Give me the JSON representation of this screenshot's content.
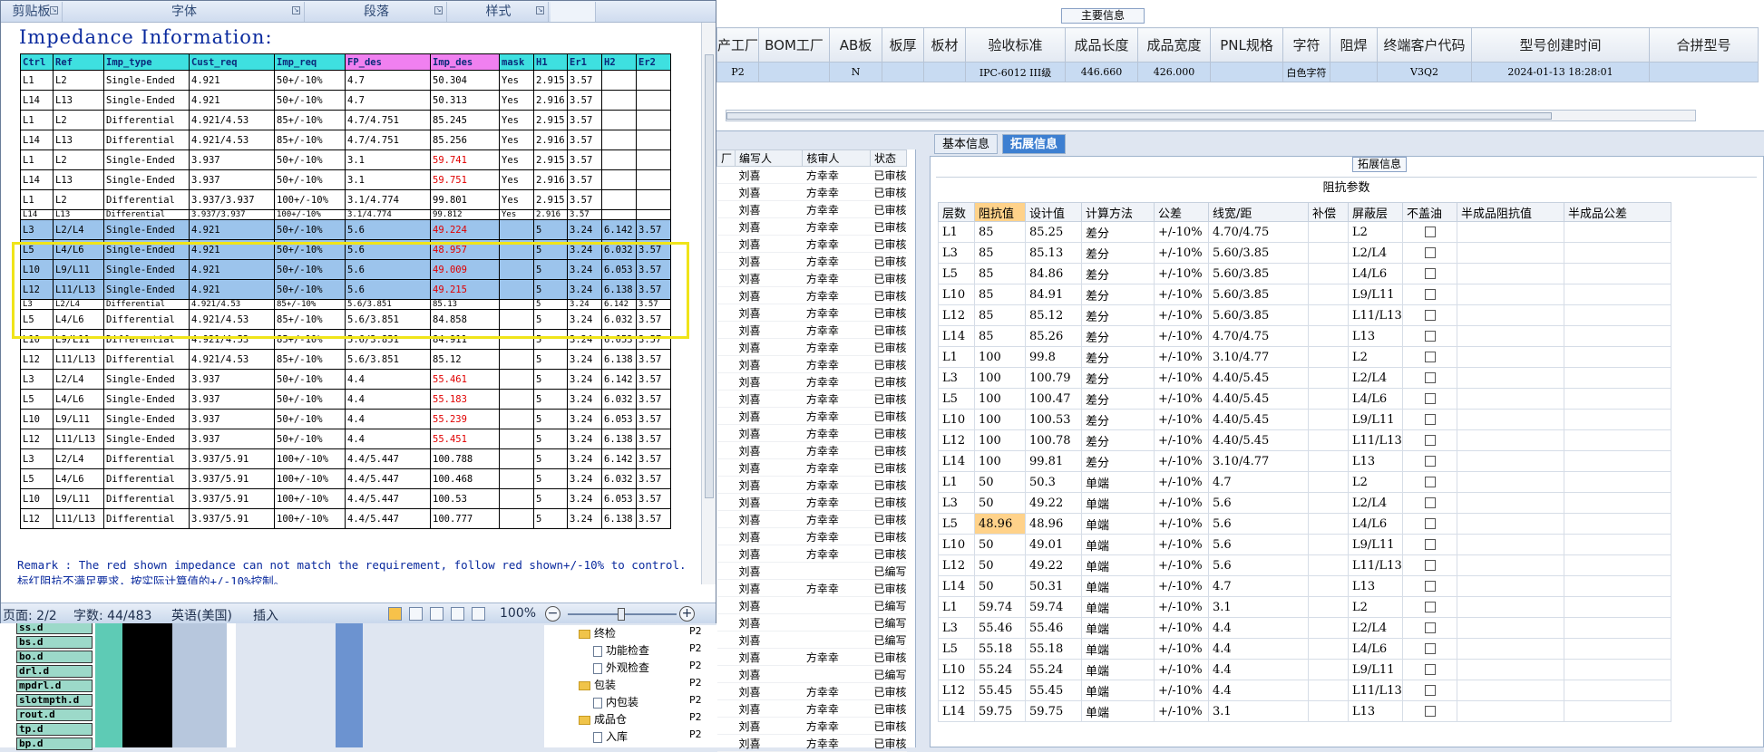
{
  "word": {
    "ribbon_groups": [
      {
        "label": "剪贴板"
      },
      {
        "label": "字体"
      },
      {
        "label": "段落"
      },
      {
        "label": "样式"
      }
    ],
    "doc_title": "Impedance Information:",
    "table_headers": [
      "Ctrl",
      "Ref",
      "Imp_type",
      "Cust_req",
      "Imp_req",
      "FP_des",
      "Imp_des",
      "mask",
      "H1",
      "Er1",
      "H2",
      "Er2"
    ],
    "header_colors": [
      "#3ee0e0",
      "#3ee0e0",
      "#3ee0e0",
      "#3ee0e0",
      "#3ee0e0",
      "#f080f0",
      "#f080f0",
      "#3ee0e0",
      "#3ee0e0",
      "#3ee0e0",
      "#3ee0e0",
      "#3ee0e0"
    ],
    "rows": [
      {
        "cells": [
          "L1",
          "L2",
          "Single-Ended",
          "4.921",
          "50+/-10%",
          "4.7",
          "50.304",
          "Yes",
          "2.915",
          "3.57",
          "",
          ""
        ]
      },
      {
        "cells": [
          "L14",
          "L13",
          "Single-Ended",
          "4.921",
          "50+/-10%",
          "4.7",
          "50.313",
          "Yes",
          "2.916",
          "3.57",
          "",
          ""
        ]
      },
      {
        "cells": [
          "L1",
          "L2",
          "Differential",
          "4.921/4.53",
          "85+/-10%",
          "4.7/4.751",
          "85.245",
          "Yes",
          "2.915",
          "3.57",
          "",
          ""
        ]
      },
      {
        "cells": [
          "L14",
          "L13",
          "Differential",
          "4.921/4.53",
          "85+/-10%",
          "4.7/4.751",
          "85.256",
          "Yes",
          "2.916",
          "3.57",
          "",
          ""
        ]
      },
      {
        "cells": [
          "L1",
          "L2",
          "Single-Ended",
          "3.937",
          "50+/-10%",
          "3.1",
          "59.741",
          "Yes",
          "2.915",
          "3.57",
          "",
          ""
        ],
        "red": true
      },
      {
        "cells": [
          "L14",
          "L13",
          "Single-Ended",
          "3.937",
          "50+/-10%",
          "3.1",
          "59.751",
          "Yes",
          "2.916",
          "3.57",
          "",
          ""
        ],
        "red": true
      },
      {
        "cells": [
          "L1",
          "L2",
          "Differential",
          "3.937/3.937",
          "100+/-10%",
          "3.1/4.774",
          "99.801",
          "Yes",
          "2.915",
          "3.57",
          "",
          ""
        ]
      },
      {
        "cells": [
          "L14",
          "L13",
          "Differential",
          "3.937/3.937",
          "100+/-10%",
          "3.1/4.774",
          "99.812",
          "Yes",
          "2.916",
          "3.57",
          "",
          ""
        ],
        "cut": true
      },
      {
        "cells": [
          "L3",
          "L2/L4",
          "Single-Ended",
          "4.921",
          "50+/-10%",
          "5.6",
          "49.224",
          "",
          "5",
          "3.24",
          "6.142",
          "3.57"
        ],
        "red": true,
        "sel": true
      },
      {
        "cells": [
          "L5",
          "L4/L6",
          "Single-Ended",
          "4.921",
          "50+/-10%",
          "5.6",
          "48.957",
          "",
          "5",
          "3.24",
          "6.032",
          "3.57"
        ],
        "red": true,
        "sel": true
      },
      {
        "cells": [
          "L10",
          "L9/L11",
          "Single-Ended",
          "4.921",
          "50+/-10%",
          "5.6",
          "49.009",
          "",
          "5",
          "3.24",
          "6.053",
          "3.57"
        ],
        "red": true,
        "sel": true
      },
      {
        "cells": [
          "L12",
          "L11/L13",
          "Single-Ended",
          "4.921",
          "50+/-10%",
          "5.6",
          "49.215",
          "",
          "5",
          "3.24",
          "6.138",
          "3.57"
        ],
        "red": true,
        "sel": true
      },
      {
        "cells": [
          "L3",
          "L2/L4",
          "Differential",
          "4.921/4.53",
          "85+/-10%",
          "5.6/3.851",
          "85.13",
          "",
          "5",
          "3.24",
          "6.142",
          "3.57"
        ],
        "cut": true
      },
      {
        "cells": [
          "L5",
          "L4/L6",
          "Differential",
          "4.921/4.53",
          "85+/-10%",
          "5.6/3.851",
          "84.858",
          "",
          "5",
          "3.24",
          "6.032",
          "3.57"
        ]
      },
      {
        "cells": [
          "L10",
          "L9/L11",
          "Differential",
          "4.921/4.53",
          "85+/-10%",
          "5.6/3.851",
          "84.911",
          "",
          "5",
          "3.24",
          "6.053",
          "3.57"
        ]
      },
      {
        "cells": [
          "L12",
          "L11/L13",
          "Differential",
          "4.921/4.53",
          "85+/-10%",
          "5.6/3.851",
          "85.12",
          "",
          "5",
          "3.24",
          "6.138",
          "3.57"
        ]
      },
      {
        "cells": [
          "L3",
          "L2/L4",
          "Single-Ended",
          "3.937",
          "50+/-10%",
          "4.4",
          "55.461",
          "",
          "5",
          "3.24",
          "6.142",
          "3.57"
        ],
        "red": true
      },
      {
        "cells": [
          "L5",
          "L4/L6",
          "Single-Ended",
          "3.937",
          "50+/-10%",
          "4.4",
          "55.183",
          "",
          "5",
          "3.24",
          "6.032",
          "3.57"
        ],
        "red": true
      },
      {
        "cells": [
          "L10",
          "L9/L11",
          "Single-Ended",
          "3.937",
          "50+/-10%",
          "4.4",
          "55.239",
          "",
          "5",
          "3.24",
          "6.053",
          "3.57"
        ],
        "red": true
      },
      {
        "cells": [
          "L12",
          "L11/L13",
          "Single-Ended",
          "3.937",
          "50+/-10%",
          "4.4",
          "55.451",
          "",
          "5",
          "3.24",
          "6.138",
          "3.57"
        ],
        "red": true
      },
      {
        "cells": [
          "L3",
          "L2/L4",
          "Differential",
          "3.937/5.91",
          "100+/-10%",
          "4.4/5.447",
          "100.788",
          "",
          "5",
          "3.24",
          "6.142",
          "3.57"
        ]
      },
      {
        "cells": [
          "L5",
          "L4/L6",
          "Differential",
          "3.937/5.91",
          "100+/-10%",
          "4.4/5.447",
          "100.468",
          "",
          "5",
          "3.24",
          "6.032",
          "3.57"
        ]
      },
      {
        "cells": [
          "L10",
          "L9/L11",
          "Differential",
          "3.937/5.91",
          "100+/-10%",
          "4.4/5.447",
          "100.53",
          "",
          "5",
          "3.24",
          "6.053",
          "3.57"
        ]
      },
      {
        "cells": [
          "L12",
          "L11/L13",
          "Differential",
          "3.937/5.91",
          "100+/-10%",
          "4.4/5.447",
          "100.777",
          "",
          "5",
          "3.24",
          "6.138",
          "3.57"
        ]
      }
    ],
    "remark": "Remark : The red shown impedance can not match the requirement, follow red shown+/-10% to control.标红阻抗不满足要求，按实际计算值的+/-10%控制。",
    "status": {
      "page": "页面: 2/2",
      "words": "字数: 44/483",
      "language": "英语(美国)",
      "mode": "插入",
      "zoom": "100%"
    }
  },
  "file_list": [
    "ss.d",
    "bs.d",
    "bo.d",
    "drl.d",
    "mpdrl.d",
    "slotmpth.d",
    "rout.d",
    "tp.d",
    "bp.d"
  ],
  "main_info": {
    "title": "主要信息",
    "headers": [
      "产工厂",
      "BOM工厂",
      "AB板",
      "板厚",
      "板材",
      "验收标准",
      "成品长度",
      "成品宽度",
      "PNL规格",
      "字符",
      "阻焊",
      "终端客户代码",
      "型号创建时间",
      "合拼型号"
    ],
    "row": [
      "P2",
      "",
      "N",
      "",
      "",
      "IPC-6012 III级",
      "446.660",
      "426.000",
      "",
      "白色字符",
      "",
      "V3Q2",
      "2024-01-13 18:28:01",
      ""
    ]
  },
  "mini_list": {
    "headers": [
      "厂",
      "编写人",
      "核审人",
      "状态"
    ],
    "rows": [
      [
        "",
        "刘喜",
        "方幸幸",
        "已审核"
      ],
      [
        "",
        "刘喜",
        "方幸幸",
        "已审核"
      ],
      [
        "",
        "刘喜",
        "方幸幸",
        "已审核"
      ],
      [
        "",
        "刘喜",
        "方幸幸",
        "已审核"
      ],
      [
        "",
        "刘喜",
        "方幸幸",
        "已审核"
      ],
      [
        "",
        "刘喜",
        "方幸幸",
        "已审核"
      ],
      [
        "",
        "刘喜",
        "方幸幸",
        "已审核"
      ],
      [
        "",
        "刘喜",
        "方幸幸",
        "已审核"
      ],
      [
        "",
        "刘喜",
        "方幸幸",
        "已审核"
      ],
      [
        "",
        "刘喜",
        "方幸幸",
        "已审核"
      ],
      [
        "",
        "刘喜",
        "方幸幸",
        "已审核"
      ],
      [
        "",
        "刘喜",
        "方幸幸",
        "已审核"
      ],
      [
        "",
        "刘喜",
        "方幸幸",
        "已审核"
      ],
      [
        "",
        "刘喜",
        "方幸幸",
        "已审核"
      ],
      [
        "",
        "刘喜",
        "方幸幸",
        "已审核"
      ],
      [
        "",
        "刘喜",
        "方幸幸",
        "已审核"
      ],
      [
        "",
        "刘喜",
        "方幸幸",
        "已审核"
      ],
      [
        "",
        "刘喜",
        "方幸幸",
        "已审核"
      ],
      [
        "",
        "刘喜",
        "方幸幸",
        "已审核"
      ],
      [
        "",
        "刘喜",
        "方幸幸",
        "已审核"
      ],
      [
        "",
        "刘喜",
        "方幸幸",
        "已审核"
      ],
      [
        "",
        "刘喜",
        "方幸幸",
        "已审核"
      ],
      [
        "",
        "刘喜",
        "方幸幸",
        "已审核"
      ],
      [
        "",
        "刘喜",
        "",
        "已编写"
      ],
      [
        "",
        "刘喜",
        "方幸幸",
        "已审核"
      ],
      [
        "",
        "刘喜",
        "",
        "已编写"
      ],
      [
        "",
        "刘喜",
        "",
        "已编写"
      ],
      [
        "",
        "刘喜",
        "",
        "已编写"
      ],
      [
        "",
        "刘喜",
        "方幸幸",
        "已审核"
      ],
      [
        "",
        "刘喜",
        "",
        "已编写"
      ],
      [
        "",
        "刘喜",
        "方幸幸",
        "已审核"
      ],
      [
        "",
        "刘喜",
        "方幸幸",
        "已审核"
      ],
      [
        "",
        "刘喜",
        "方幸幸",
        "已审核"
      ],
      [
        "",
        "刘喜",
        "方幸幸",
        "已审核"
      ]
    ]
  },
  "tree": [
    {
      "label": "终检",
      "type": "folder",
      "plant": "P2",
      "indent": 0
    },
    {
      "label": "功能检查",
      "type": "doc",
      "plant": "P2",
      "indent": 1
    },
    {
      "label": "外观检查",
      "type": "doc",
      "plant": "P2",
      "indent": 1
    },
    {
      "label": "包装",
      "type": "folder",
      "plant": "P2",
      "indent": 0
    },
    {
      "label": "内包装",
      "type": "doc",
      "plant": "P2",
      "indent": 1
    },
    {
      "label": "成品仓",
      "type": "folder",
      "plant": "P2",
      "indent": 0
    },
    {
      "label": "入库",
      "type": "doc",
      "plant": "P2",
      "indent": 1
    }
  ],
  "tabs": [
    {
      "label": "基本信息",
      "active": false
    },
    {
      "label": "拓展信息",
      "active": true
    }
  ],
  "ext": {
    "section_title": "拓展信息",
    "sub_title": "阻抗参数",
    "headers": [
      "层数",
      "阻抗值",
      "设计值",
      "计算方法",
      "公差",
      "线宽/距",
      "补偿",
      "屏蔽层",
      "不盖油",
      "半成品阻抗值",
      "半成品公差"
    ],
    "rows": [
      [
        "L1",
        "85",
        "85.25",
        "差分",
        "+/-10%",
        "4.70/4.75",
        "",
        "L2"
      ],
      [
        "L3",
        "85",
        "85.13",
        "差分",
        "+/-10%",
        "5.60/3.85",
        "",
        "L2/L4"
      ],
      [
        "L5",
        "85",
        "84.86",
        "差分",
        "+/-10%",
        "5.60/3.85",
        "",
        "L4/L6"
      ],
      [
        "L10",
        "85",
        "84.91",
        "差分",
        "+/-10%",
        "5.60/3.85",
        "",
        "L9/L11"
      ],
      [
        "L12",
        "85",
        "85.12",
        "差分",
        "+/-10%",
        "5.60/3.85",
        "",
        "L11/L13"
      ],
      [
        "L14",
        "85",
        "85.26",
        "差分",
        "+/-10%",
        "4.70/4.75",
        "",
        "L13"
      ],
      [
        "L1",
        "100",
        "99.8",
        "差分",
        "+/-10%",
        "3.10/4.77",
        "",
        "L2"
      ],
      [
        "L3",
        "100",
        "100.79",
        "差分",
        "+/-10%",
        "4.40/5.45",
        "",
        "L2/L4"
      ],
      [
        "L5",
        "100",
        "100.47",
        "差分",
        "+/-10%",
        "4.40/5.45",
        "",
        "L4/L6"
      ],
      [
        "L10",
        "100",
        "100.53",
        "差分",
        "+/-10%",
        "4.40/5.45",
        "",
        "L9/L11"
      ],
      [
        "L12",
        "100",
        "100.78",
        "差分",
        "+/-10%",
        "4.40/5.45",
        "",
        "L11/L13"
      ],
      [
        "L14",
        "100",
        "99.81",
        "差分",
        "+/-10%",
        "3.10/4.77",
        "",
        "L13"
      ],
      [
        "L1",
        "50",
        "50.3",
        "单端",
        "+/-10%",
        "4.7",
        "",
        "L2"
      ],
      [
        "L3",
        "50",
        "49.22",
        "单端",
        "+/-10%",
        "5.6",
        "",
        "L2/L4"
      ],
      [
        "L5",
        "48.96",
        "48.96",
        "单端",
        "+/-10%",
        "5.6",
        "",
        "L4/L6"
      ],
      [
        "L10",
        "50",
        "49.01",
        "单端",
        "+/-10%",
        "5.6",
        "",
        "L9/L11"
      ],
      [
        "L12",
        "50",
        "49.22",
        "单端",
        "+/-10%",
        "5.6",
        "",
        "L11/L13"
      ],
      [
        "L14",
        "50",
        "50.31",
        "单端",
        "+/-10%",
        "4.7",
        "",
        "L13"
      ],
      [
        "L1",
        "59.74",
        "59.74",
        "单端",
        "+/-10%",
        "3.1",
        "",
        "L2"
      ],
      [
        "L3",
        "55.46",
        "55.46",
        "单端",
        "+/-10%",
        "4.4",
        "",
        "L2/L4"
      ],
      [
        "L5",
        "55.18",
        "55.18",
        "单端",
        "+/-10%",
        "4.4",
        "",
        "L4/L6"
      ],
      [
        "L10",
        "55.24",
        "55.24",
        "单端",
        "+/-10%",
        "4.4",
        "",
        "L9/L11"
      ],
      [
        "L12",
        "55.45",
        "55.45",
        "单端",
        "+/-10%",
        "4.4",
        "",
        "L11/L13"
      ],
      [
        "L14",
        "59.75",
        "59.75",
        "单端",
        "+/-10%",
        "3.1",
        "",
        "L13"
      ]
    ],
    "highlight_row": 14
  }
}
